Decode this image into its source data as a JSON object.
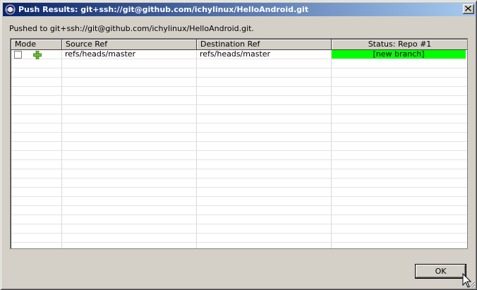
{
  "window": {
    "title": "Push Results: git+ssh://git@github.com/ichylinux/HelloAndroid.git",
    "message": "Pushed to git+ssh://git@github.com/ichylinux/HelloAndroid.git."
  },
  "table": {
    "columns": [
      "Mode",
      "Source Ref",
      "Destination Ref",
      "Status: Repo #1"
    ],
    "rows": [
      {
        "mode_icon": "add-icon",
        "source": "refs/heads/master",
        "destination": "refs/heads/master",
        "status": "[new branch]",
        "status_color": "#00ff00"
      }
    ]
  },
  "buttons": {
    "ok_label": "OK"
  },
  "colors": {
    "title_bar_start": "#0a246a",
    "title_bar_end": "#a6caf0",
    "dialog_bg": "#d4d0c8",
    "status_new_branch": "#00ff00"
  }
}
